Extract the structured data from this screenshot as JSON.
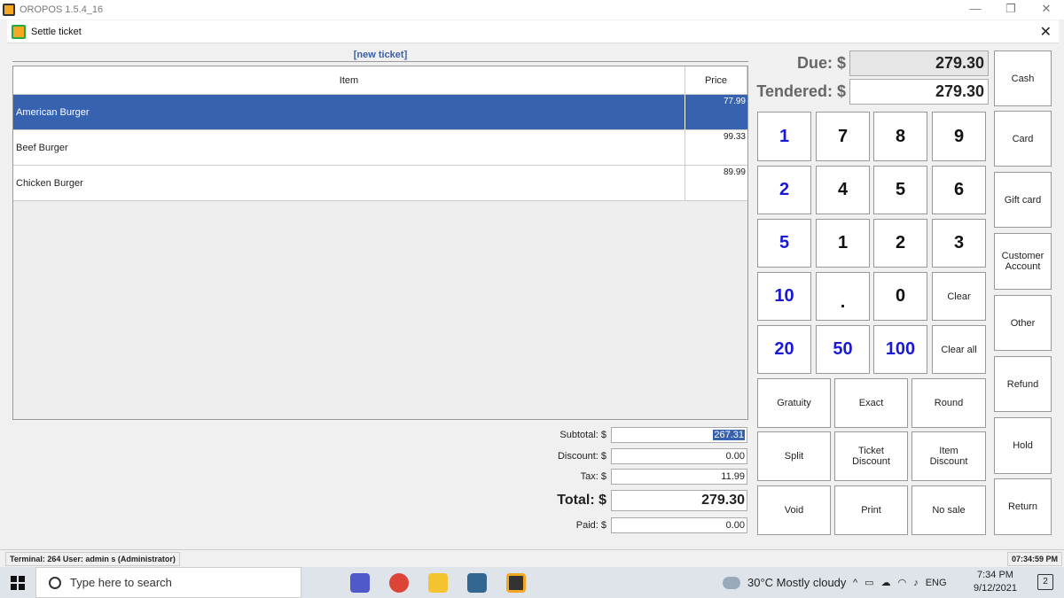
{
  "window": {
    "title": "OROPOS 1.5.4_16",
    "minimize": "—",
    "maximize": "❐",
    "close": "✕"
  },
  "dialog": {
    "title": "Settle ticket",
    "close": "✕"
  },
  "ticket": {
    "label": "[new ticket]",
    "columns": {
      "item": "Item",
      "price": "Price"
    },
    "rows": [
      {
        "item": "American Burger",
        "price": "77.99",
        "selected": true
      },
      {
        "item": "Beef Burger",
        "price": "99.33",
        "selected": false
      },
      {
        "item": "Chicken Burger",
        "price": "89.99",
        "selected": false
      }
    ]
  },
  "totals": {
    "subtotal_label": "Subtotal: $",
    "subtotal": "267.31",
    "discount_label": "Discount: $",
    "discount": "0.00",
    "tax_label": "Tax: $",
    "tax": "11.99",
    "total_label": "Total: $",
    "total": "279.30",
    "paid_label": "Paid: $",
    "paid": "0.00"
  },
  "payment": {
    "due_label": "Due: $",
    "due": "279.30",
    "tendered_label": "Tendered: $",
    "tendered": "279.30"
  },
  "keypad": {
    "r1": [
      "1",
      "7",
      "8",
      "9"
    ],
    "r2": [
      "2",
      "4",
      "5",
      "6"
    ],
    "r3": [
      "5",
      "1",
      "2",
      "3"
    ],
    "r4": [
      "10",
      ".",
      "0",
      "Clear"
    ],
    "r5": [
      "20",
      "50",
      "100",
      "Clear all"
    ]
  },
  "actions": {
    "gratuity": "Gratuity",
    "exact": "Exact",
    "round": "Round",
    "split": "Split",
    "ticket_discount": "Ticket Discount",
    "item_discount": "Item Discount",
    "void": "Void",
    "print": "Print",
    "no_sale": "No sale"
  },
  "methods": {
    "cash": "Cash",
    "card": "Card",
    "gift_card": "Gift card",
    "customer_account": "Customer Account",
    "other": "Other",
    "refund": "Refund",
    "hold": "Hold",
    "return": "Return"
  },
  "status": {
    "left": "Terminal: 264 User: admin s (Administrator)",
    "time": "07:34:59 PM"
  },
  "taskbar": {
    "search_placeholder": "Type here to search",
    "weather": "30°C  Mostly cloudy",
    "lang": "ENG",
    "clock_time": "7:34 PM",
    "clock_date": "9/12/2021",
    "notif_count": "2"
  }
}
